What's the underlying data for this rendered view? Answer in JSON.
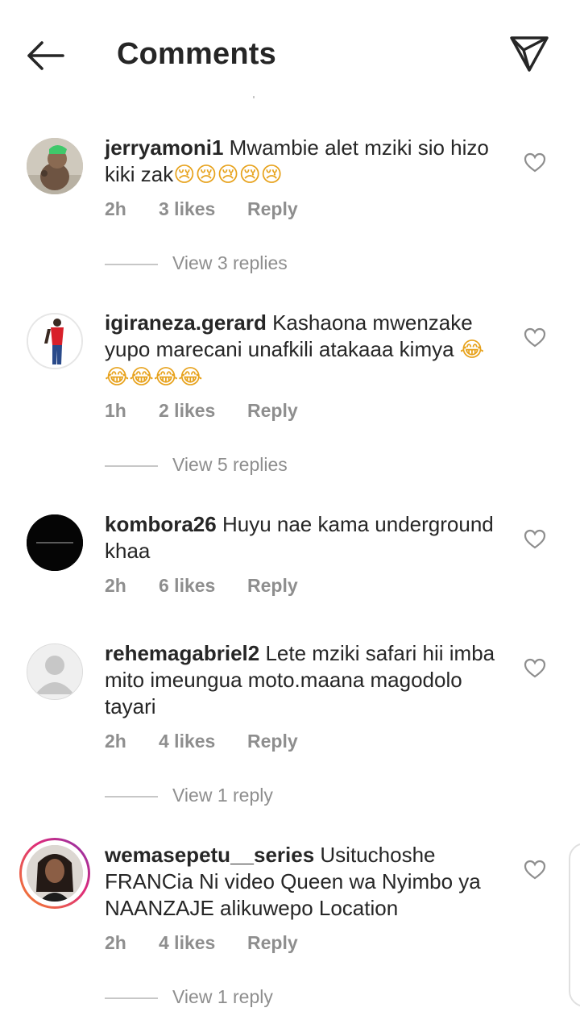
{
  "header": {
    "title": "Comments",
    "back_icon": "arrow-left-icon",
    "share_icon": "paper-plane-icon"
  },
  "colors": {
    "text": "#262626",
    "muted": "#8e8e8e",
    "divider": "#c7c7c7",
    "story_ring_start": "#f58529",
    "story_ring_end": "#dd2a7b"
  },
  "comments": [
    {
      "username": "jerryamoni1",
      "text": "Mwambie alet mziki sio hizo kiki zak",
      "emoji": "😢😢😢😢😢",
      "time": "2h",
      "likes": "3 likes",
      "reply": "Reply",
      "view_replies": "View 3 replies"
    },
    {
      "username": "igiraneza.gerard",
      "text": "Kashaona mwenzake yupo marecani unafkili atakaaa kimya",
      "emoji": "😂😂😂😂😂",
      "time": "1h",
      "likes": "2 likes",
      "reply": "Reply",
      "view_replies": "View 5 replies"
    },
    {
      "username": "kombora26",
      "text": "Huyu nae kama underground khaa",
      "emoji": "",
      "time": "2h",
      "likes": "6 likes",
      "reply": "Reply",
      "view_replies": ""
    },
    {
      "username": "rehemagabriel2",
      "text": "Lete mziki safari hii imba mito imeungua moto.maana magodolo tayari",
      "emoji": "",
      "time": "2h",
      "likes": "4 likes",
      "reply": "Reply",
      "view_replies": "View 1 reply"
    },
    {
      "username": "wemasepetu__series",
      "text": "Usituchoshe FRANCia Ni video Queen wa Nyimbo ya NAANZAJE alikuwepo Location",
      "emoji": "",
      "time": "2h",
      "likes": "4 likes",
      "reply": "Reply",
      "view_replies": "View 1 reply"
    }
  ]
}
